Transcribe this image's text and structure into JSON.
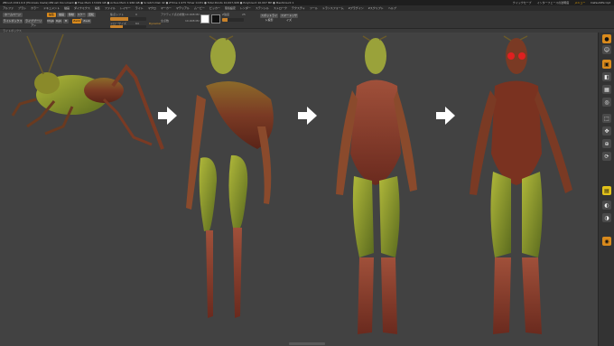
{
  "titlebar": {
    "title": "ZBrush 2021.6.6 [Hirokazu Ikeda] ZBrush Document  ● Free Mem 13.649 GB  ● Active Mem 1.966 GB  ● Scratch Disk 42  ● ZTime 1.975 Timer 0.031  ● Total Points 10,007,908  ● PolyCount 10.007 MP  ● MeshCount 1",
    "quicksave": "クイックセーブ",
    "ui_opacity": "インターフェースの透明度",
    "menu_label": "メニュー",
    "default_script": "DefaultZScript"
  },
  "menubar": [
    "アルファ",
    "ブラシ",
    "カラー",
    "ドキュメント",
    "描画",
    "ダイナミクス",
    "編集",
    "ファイル",
    "レイヤー",
    "ライト",
    "マクロ",
    "マーカー",
    "マテリアル",
    "ムービー",
    "ピッカー",
    "環境設定",
    "レンダー",
    "ステンシル",
    "ストローク",
    "テクスチャ",
    "ツール",
    "トランスフォーム",
    "Zプラグイン",
    "Zスクリプト",
    "ヘルプ"
  ],
  "toolbar": {
    "home": "ホームページ",
    "lightbox": "ライトボックス",
    "live_boolean": "ライブブーリアン",
    "edit": "編集",
    "draw": "描画",
    "move": "移動",
    "scale": "スケール",
    "rotate": "回転",
    "mrgb": "Mrgb",
    "rgb": "Rgb",
    "m": "M",
    "zadd": "Zadd",
    "zsub": "Zsub",
    "focal_shift": "焦点シフト",
    "focal_value": "0",
    "draw_size": "ドローサイズ",
    "draw_size_value": "64",
    "dynamic": "Dynamic",
    "z_intensity": "Z強度",
    "z_intensity_value": "25",
    "active_points_label": "アクティブ点の総数",
    "active_points": "10.008 Mil",
    "total_points_label": "全点数",
    "total_points": "10.008 Mil",
    "spotlight": "スポットライト投影",
    "use_smooth": "スマートリサイズ"
  },
  "status_text": "ライトボックス",
  "shelf": {
    "items": [
      "BPR",
      "SPix",
      "3",
      "Persp",
      "Floor",
      "Local",
      "XYZ",
      "Frame",
      "Move",
      "Zoom3D",
      "Rotate",
      "Transp",
      "Solo",
      "Xpose"
    ]
  },
  "colors": {
    "background": "#424242",
    "accent": "#d98a1c",
    "toolbar": "#353535"
  }
}
